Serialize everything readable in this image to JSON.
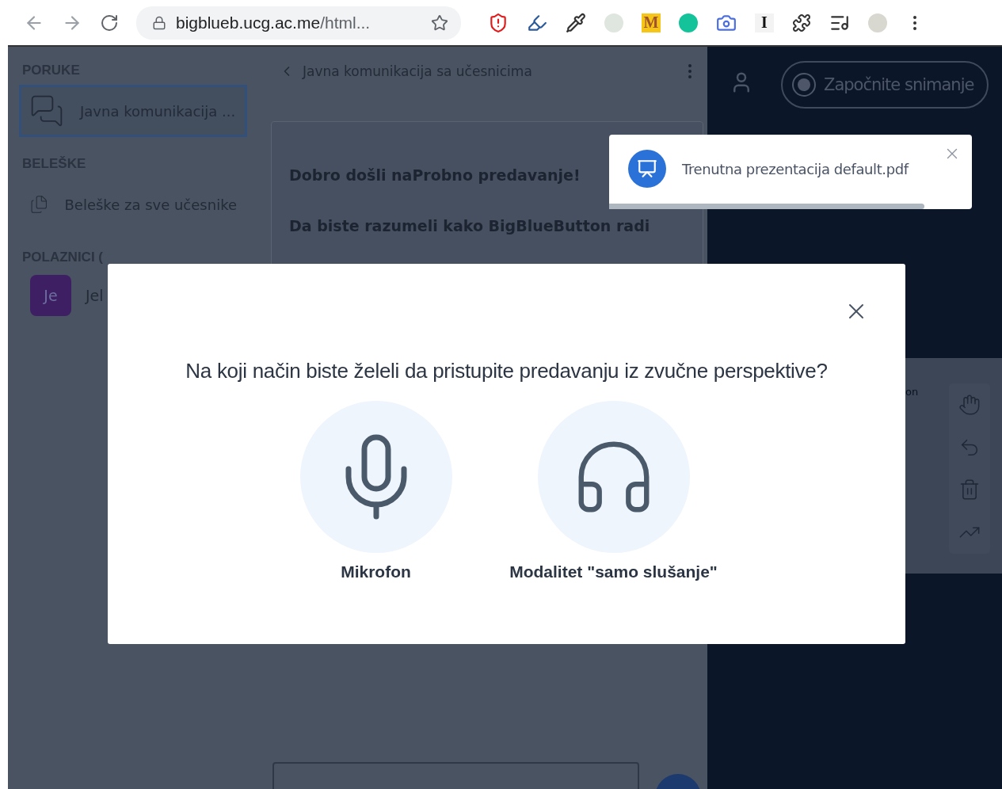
{
  "browser": {
    "url_host": "bigblueb.ucg.ac.me",
    "url_rest": "/html...",
    "extension_letters": [
      "M",
      "I"
    ]
  },
  "sidebar": {
    "sections": [
      {
        "title": "PORUKE",
        "items": [
          {
            "kind": "chat",
            "label": "Javna komunikacija ...",
            "selected": true
          }
        ]
      },
      {
        "title": "BELEŠKE",
        "items": [
          {
            "kind": "notes",
            "label": "Beleške za sve učesnike",
            "selected": false
          }
        ]
      },
      {
        "title": "POLAZNICI (",
        "users": [
          {
            "initials": "Je",
            "name": "Jel"
          }
        ]
      }
    ]
  },
  "chat": {
    "title": "Javna komunikacija sa učesnicima",
    "messages": [
      "Dobro došli naProbno predavanje!",
      "Da biste razumeli kako BigBlueButton radi"
    ]
  },
  "header": {
    "record_label": "Započnite snimanje"
  },
  "whiteboard": {
    "slide_text": "on"
  },
  "toast": {
    "text": "Trenutna prezentacija default.pdf",
    "level": 0.87
  },
  "modal": {
    "question": "Na koji način biste želeli da pristupite predavanju iz zvučne perspektive?",
    "options": [
      {
        "kind": "microphone",
        "label": "Mikrofon"
      },
      {
        "kind": "listen",
        "label": "Modalitet \"samo slušanje\""
      }
    ]
  }
}
